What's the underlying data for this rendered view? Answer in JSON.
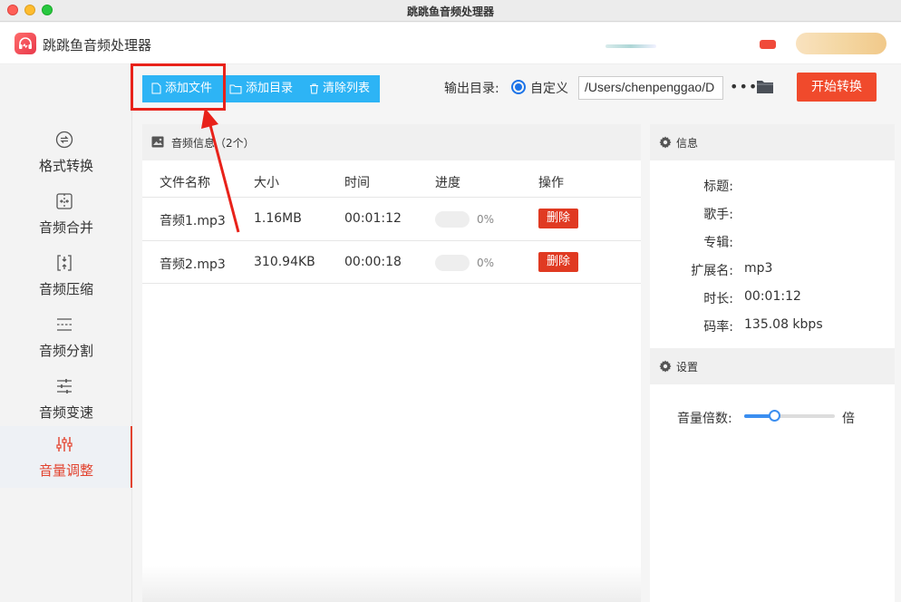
{
  "window": {
    "title": "跳跳鱼音频处理器"
  },
  "app": {
    "name": "跳跳鱼音频处理器"
  },
  "sidebar": {
    "items": [
      {
        "label": "格式转换",
        "icon": "format-convert-icon",
        "active": false
      },
      {
        "label": "音频合并",
        "icon": "merge-icon",
        "active": false
      },
      {
        "label": "音频压缩",
        "icon": "compress-icon",
        "active": false
      },
      {
        "label": "音频分割",
        "icon": "split-icon",
        "active": false
      },
      {
        "label": "音频变速",
        "icon": "speed-icon",
        "active": false
      },
      {
        "label": "音量调整",
        "icon": "volume-adjust-icon",
        "active": true
      }
    ]
  },
  "toolbar": {
    "add_file": "添加文件",
    "add_folder": "添加目录",
    "clear_list": "清除列表",
    "output_label": "输出目录:",
    "custom_option": "自定义",
    "output_path": "/Users/chenpenggao/D",
    "more": "•••",
    "start": "开始转换"
  },
  "file_panel": {
    "header": "音频信息（2个）",
    "columns": [
      "文件名称",
      "大小",
      "时间",
      "进度",
      "操作"
    ],
    "rows": [
      {
        "name": "音频1.mp3",
        "size": "1.16MB",
        "time": "00:01:12",
        "progress": "0%",
        "action": "删除"
      },
      {
        "name": "音频2.mp3",
        "size": "310.94KB",
        "time": "00:00:18",
        "progress": "0%",
        "action": "删除"
      }
    ]
  },
  "info": {
    "header": "信息",
    "fields": [
      {
        "label": "标题:",
        "value": ""
      },
      {
        "label": "歌手:",
        "value": ""
      },
      {
        "label": "专辑:",
        "value": ""
      },
      {
        "label": "扩展名:",
        "value": "mp3"
      },
      {
        "label": "时长:",
        "value": "00:01:12"
      },
      {
        "label": "码率:",
        "value": "135.08 kbps"
      }
    ]
  },
  "settings": {
    "header": "设置",
    "volume_label": "音量倍数:",
    "volume_unit": "倍",
    "volume_level": 0.33
  },
  "colors": {
    "accent_red": "#e2432f",
    "toolbar_blue": "#2db4f5",
    "start_button": "#f04a2c",
    "slider_blue": "#3b8ef0"
  }
}
